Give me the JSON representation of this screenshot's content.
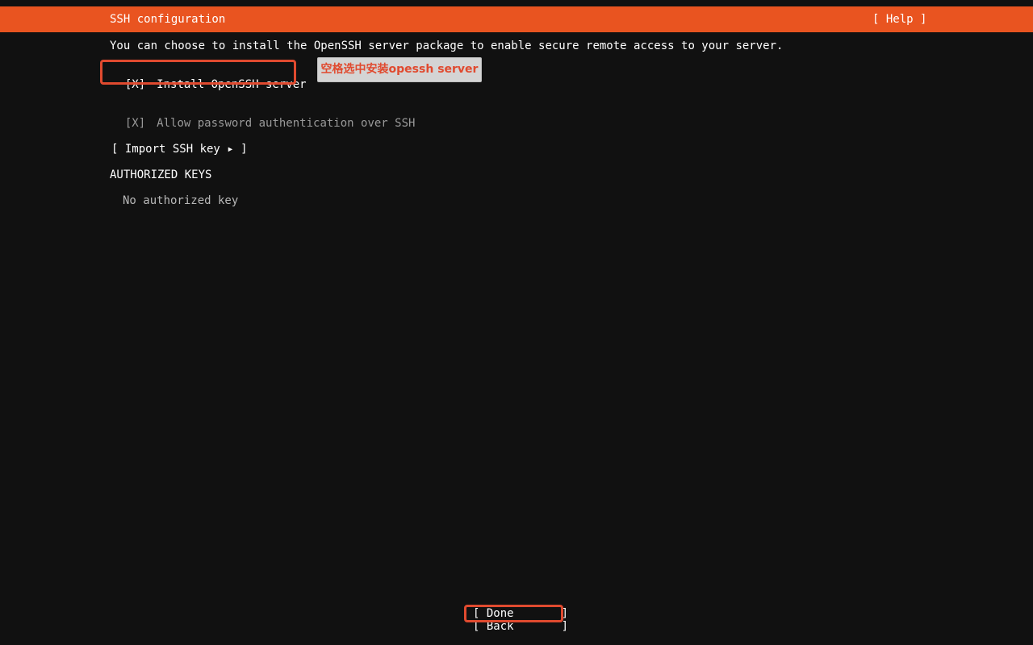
{
  "header": {
    "title": "SSH configuration",
    "help_label": "[ Help ]",
    "color": "#e95420"
  },
  "description": "You can choose to install the OpenSSH server package to enable secure remote access to your server.",
  "install_openssh": {
    "checkbox": "[X]",
    "label": "Install OpenSSH server",
    "checked": true
  },
  "allow_password": {
    "checkbox": "[X]",
    "label": "Allow password authentication over SSH",
    "checked": true,
    "enabled": false
  },
  "import_key_button": "[ Import SSH key ▸ ]",
  "authorized_keys": {
    "title": "AUTHORIZED KEYS",
    "empty_text": "No authorized key"
  },
  "annotation": {
    "text": "空格选中安装opessh server",
    "color": "#e04a2f"
  },
  "footer": {
    "done_label": "[ Done       ]",
    "back_label": "[ Back       ]"
  }
}
